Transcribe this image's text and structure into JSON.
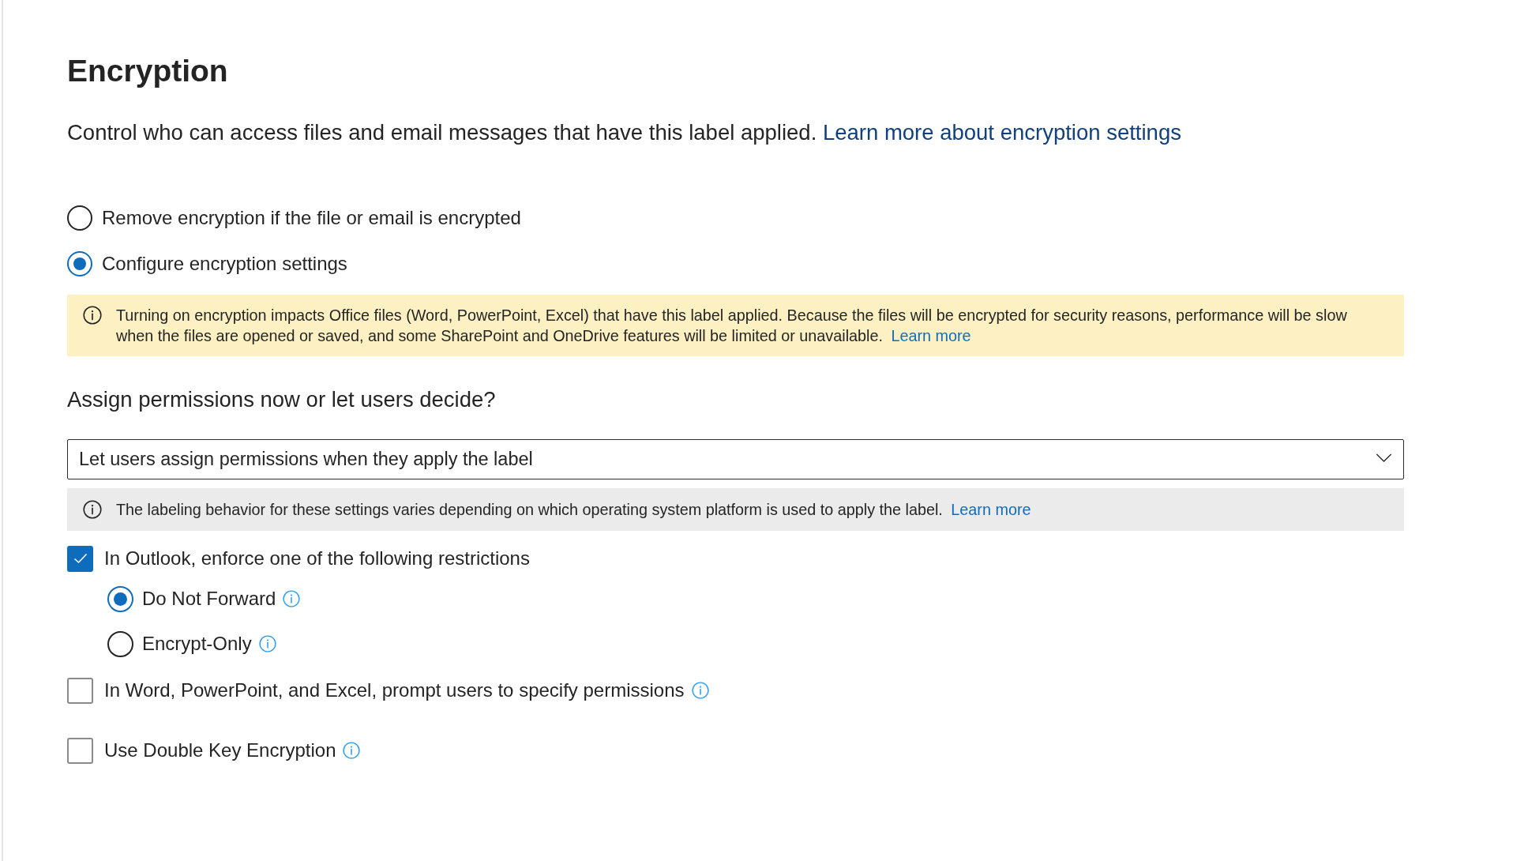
{
  "title": "Encryption",
  "description": {
    "text": "Control who can access files and email messages that have this label applied.",
    "link": "Learn more about encryption settings"
  },
  "encryption_options": [
    {
      "label": "Remove encryption if the file or email is encrypted",
      "selected": false
    },
    {
      "label": "Configure encryption settings",
      "selected": true
    }
  ],
  "warning": {
    "text": "Turning on encryption impacts Office files (Word, PowerPoint, Excel) that have this label applied. Because the files will be encrypted for security reasons, performance will be slow when the files are opened or saved, and some SharePoint and OneDrive features will be limited or unavailable.",
    "link": "Learn more"
  },
  "permissions": {
    "heading": "Assign permissions now or let users decide?",
    "dropdown": {
      "value": "Let users assign permissions when they apply the label"
    },
    "note": {
      "text": "The labeling behavior for these settings varies depending on which operating system platform is used to apply the label.",
      "link": "Learn more"
    }
  },
  "options": [
    {
      "label": "In Outlook, enforce one of the following restrictions",
      "checked": true,
      "info": false,
      "restrictions": [
        {
          "label": "Do Not Forward",
          "selected": true,
          "info": true
        },
        {
          "label": "Encrypt-Only",
          "selected": false,
          "info": true
        }
      ]
    },
    {
      "label": "In Word, PowerPoint, and Excel, prompt users to specify permissions",
      "checked": false,
      "info": true
    },
    {
      "label": "Use Double Key Encryption",
      "checked": false,
      "info": true
    }
  ]
}
